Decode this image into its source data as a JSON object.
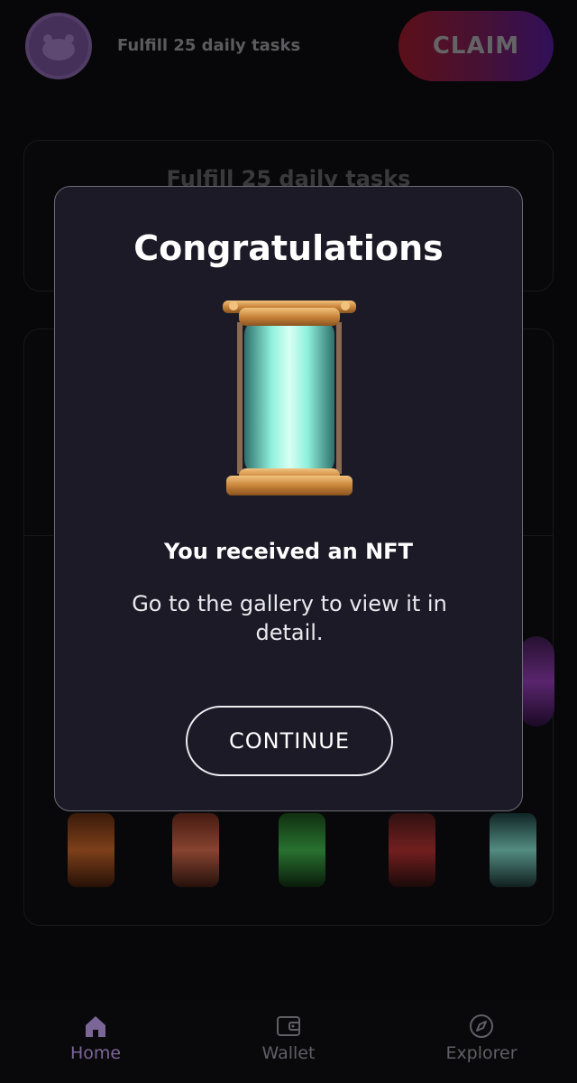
{
  "top_bar": {
    "task_title": "Fulfill 25 daily tasks",
    "claim_label": "CLAIM"
  },
  "card": {
    "title": "Fulfill 25 daily tasks"
  },
  "modal": {
    "title": "Congratulations",
    "subtitle": "You received an NFT",
    "description": "Go to the gallery to view it in detail.",
    "continue_label": "CONTINUE",
    "image_icon": "nft-capsule-icon"
  },
  "bottom_nav": {
    "items": [
      {
        "label": "Home",
        "icon": "home-icon",
        "active": true
      },
      {
        "label": "Wallet",
        "icon": "wallet-icon",
        "active": false
      },
      {
        "label": "Explorer",
        "icon": "compass-icon",
        "active": false
      }
    ]
  },
  "colors": {
    "accent": "#7c6597",
    "claim_gradient_start": "#8d1a26",
    "claim_gradient_end": "#4b1a8a",
    "modal_bg": "#1b1a26"
  }
}
